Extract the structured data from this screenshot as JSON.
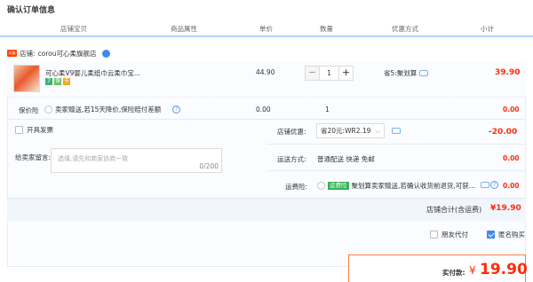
{
  "page_title": "确认订单信息",
  "columns": [
    "店铺宝贝",
    "商品属性",
    "单价",
    "数量",
    "优惠方式",
    "小计"
  ],
  "shop": {
    "badge": "天猫",
    "label": "店铺: ",
    "name": "corou可心柔旗舰店"
  },
  "item": {
    "name": "可心柔V9婴儿柔纸巾云柔巾宝...",
    "price": "44.90",
    "quantity": "1",
    "promo": "省5:聚划算",
    "subtotal": "39.90",
    "tags": [
      {
        "text": "7",
        "color": "#3db37a"
      },
      {
        "text": "保",
        "color": "#6dc15a"
      },
      {
        "text": "卡",
        "color": "#f5a623"
      }
    ]
  },
  "guarantee": {
    "label": "保价险",
    "desc": "卖家赠送,若15天降价,保险赔付差额",
    "price": "0.00",
    "quantity": "1",
    "subtotal": "0.00"
  },
  "invoice": {
    "label": "开具发票"
  },
  "shop_discount": {
    "label": "店铺优惠:",
    "option": "省20元:WR2.19",
    "value": "-20.00"
  },
  "note": {
    "label": "给卖家留言:",
    "placeholder": "选填,请先和商家协商一致",
    "counter": "0/200"
  },
  "shipping": {
    "label": "运送方式:",
    "method": "普通配送 快递 免邮",
    "value": "0.00"
  },
  "freight_insurance": {
    "label": "运费险:",
    "tag": "运费险",
    "desc": "聚划算卖家赠送,若确认收货前退货,可获...",
    "value": "0.00"
  },
  "store_total": {
    "label": "店铺合计(含运费)",
    "value": "¥19.90"
  },
  "options": {
    "friend_pay": "朋友代付",
    "anonymous": "匿名购买"
  },
  "pay": {
    "label": "实付款:",
    "currency": "¥",
    "amount": "19.90"
  },
  "colors": {
    "accent_red": "#ff2b0a",
    "link_blue": "#3e8ae8",
    "header_line": "#b2d1ff"
  }
}
